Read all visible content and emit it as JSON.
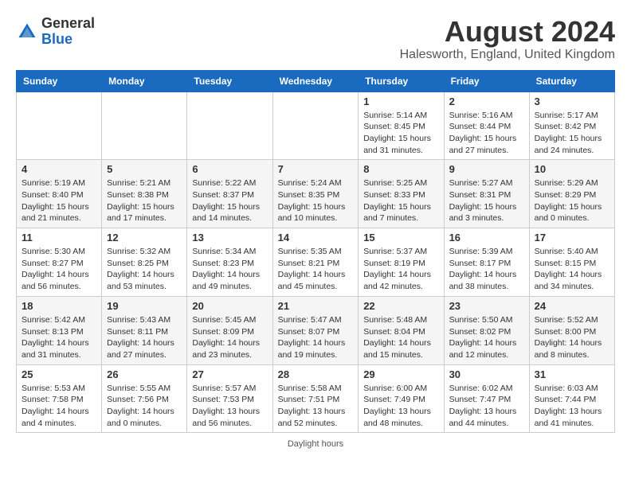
{
  "header": {
    "logo_general": "General",
    "logo_blue": "Blue",
    "month_year": "August 2024",
    "location": "Halesworth, England, United Kingdom"
  },
  "calendar": {
    "days_of_week": [
      "Sunday",
      "Monday",
      "Tuesday",
      "Wednesday",
      "Thursday",
      "Friday",
      "Saturday"
    ],
    "weeks": [
      [
        {
          "day": "",
          "info": ""
        },
        {
          "day": "",
          "info": ""
        },
        {
          "day": "",
          "info": ""
        },
        {
          "day": "",
          "info": ""
        },
        {
          "day": "1",
          "info": "Sunrise: 5:14 AM\nSunset: 8:45 PM\nDaylight: 15 hours\nand 31 minutes."
        },
        {
          "day": "2",
          "info": "Sunrise: 5:16 AM\nSunset: 8:44 PM\nDaylight: 15 hours\nand 27 minutes."
        },
        {
          "day": "3",
          "info": "Sunrise: 5:17 AM\nSunset: 8:42 PM\nDaylight: 15 hours\nand 24 minutes."
        }
      ],
      [
        {
          "day": "4",
          "info": "Sunrise: 5:19 AM\nSunset: 8:40 PM\nDaylight: 15 hours\nand 21 minutes."
        },
        {
          "day": "5",
          "info": "Sunrise: 5:21 AM\nSunset: 8:38 PM\nDaylight: 15 hours\nand 17 minutes."
        },
        {
          "day": "6",
          "info": "Sunrise: 5:22 AM\nSunset: 8:37 PM\nDaylight: 15 hours\nand 14 minutes."
        },
        {
          "day": "7",
          "info": "Sunrise: 5:24 AM\nSunset: 8:35 PM\nDaylight: 15 hours\nand 10 minutes."
        },
        {
          "day": "8",
          "info": "Sunrise: 5:25 AM\nSunset: 8:33 PM\nDaylight: 15 hours\nand 7 minutes."
        },
        {
          "day": "9",
          "info": "Sunrise: 5:27 AM\nSunset: 8:31 PM\nDaylight: 15 hours\nand 3 minutes."
        },
        {
          "day": "10",
          "info": "Sunrise: 5:29 AM\nSunset: 8:29 PM\nDaylight: 15 hours\nand 0 minutes."
        }
      ],
      [
        {
          "day": "11",
          "info": "Sunrise: 5:30 AM\nSunset: 8:27 PM\nDaylight: 14 hours\nand 56 minutes."
        },
        {
          "day": "12",
          "info": "Sunrise: 5:32 AM\nSunset: 8:25 PM\nDaylight: 14 hours\nand 53 minutes."
        },
        {
          "day": "13",
          "info": "Sunrise: 5:34 AM\nSunset: 8:23 PM\nDaylight: 14 hours\nand 49 minutes."
        },
        {
          "day": "14",
          "info": "Sunrise: 5:35 AM\nSunset: 8:21 PM\nDaylight: 14 hours\nand 45 minutes."
        },
        {
          "day": "15",
          "info": "Sunrise: 5:37 AM\nSunset: 8:19 PM\nDaylight: 14 hours\nand 42 minutes."
        },
        {
          "day": "16",
          "info": "Sunrise: 5:39 AM\nSunset: 8:17 PM\nDaylight: 14 hours\nand 38 minutes."
        },
        {
          "day": "17",
          "info": "Sunrise: 5:40 AM\nSunset: 8:15 PM\nDaylight: 14 hours\nand 34 minutes."
        }
      ],
      [
        {
          "day": "18",
          "info": "Sunrise: 5:42 AM\nSunset: 8:13 PM\nDaylight: 14 hours\nand 31 minutes."
        },
        {
          "day": "19",
          "info": "Sunrise: 5:43 AM\nSunset: 8:11 PM\nDaylight: 14 hours\nand 27 minutes."
        },
        {
          "day": "20",
          "info": "Sunrise: 5:45 AM\nSunset: 8:09 PM\nDaylight: 14 hours\nand 23 minutes."
        },
        {
          "day": "21",
          "info": "Sunrise: 5:47 AM\nSunset: 8:07 PM\nDaylight: 14 hours\nand 19 minutes."
        },
        {
          "day": "22",
          "info": "Sunrise: 5:48 AM\nSunset: 8:04 PM\nDaylight: 14 hours\nand 15 minutes."
        },
        {
          "day": "23",
          "info": "Sunrise: 5:50 AM\nSunset: 8:02 PM\nDaylight: 14 hours\nand 12 minutes."
        },
        {
          "day": "24",
          "info": "Sunrise: 5:52 AM\nSunset: 8:00 PM\nDaylight: 14 hours\nand 8 minutes."
        }
      ],
      [
        {
          "day": "25",
          "info": "Sunrise: 5:53 AM\nSunset: 7:58 PM\nDaylight: 14 hours\nand 4 minutes."
        },
        {
          "day": "26",
          "info": "Sunrise: 5:55 AM\nSunset: 7:56 PM\nDaylight: 14 hours\nand 0 minutes."
        },
        {
          "day": "27",
          "info": "Sunrise: 5:57 AM\nSunset: 7:53 PM\nDaylight: 13 hours\nand 56 minutes."
        },
        {
          "day": "28",
          "info": "Sunrise: 5:58 AM\nSunset: 7:51 PM\nDaylight: 13 hours\nand 52 minutes."
        },
        {
          "day": "29",
          "info": "Sunrise: 6:00 AM\nSunset: 7:49 PM\nDaylight: 13 hours\nand 48 minutes."
        },
        {
          "day": "30",
          "info": "Sunrise: 6:02 AM\nSunset: 7:47 PM\nDaylight: 13 hours\nand 44 minutes."
        },
        {
          "day": "31",
          "info": "Sunrise: 6:03 AM\nSunset: 7:44 PM\nDaylight: 13 hours\nand 41 minutes."
        }
      ]
    ]
  },
  "footer": {
    "note": "Daylight hours"
  }
}
